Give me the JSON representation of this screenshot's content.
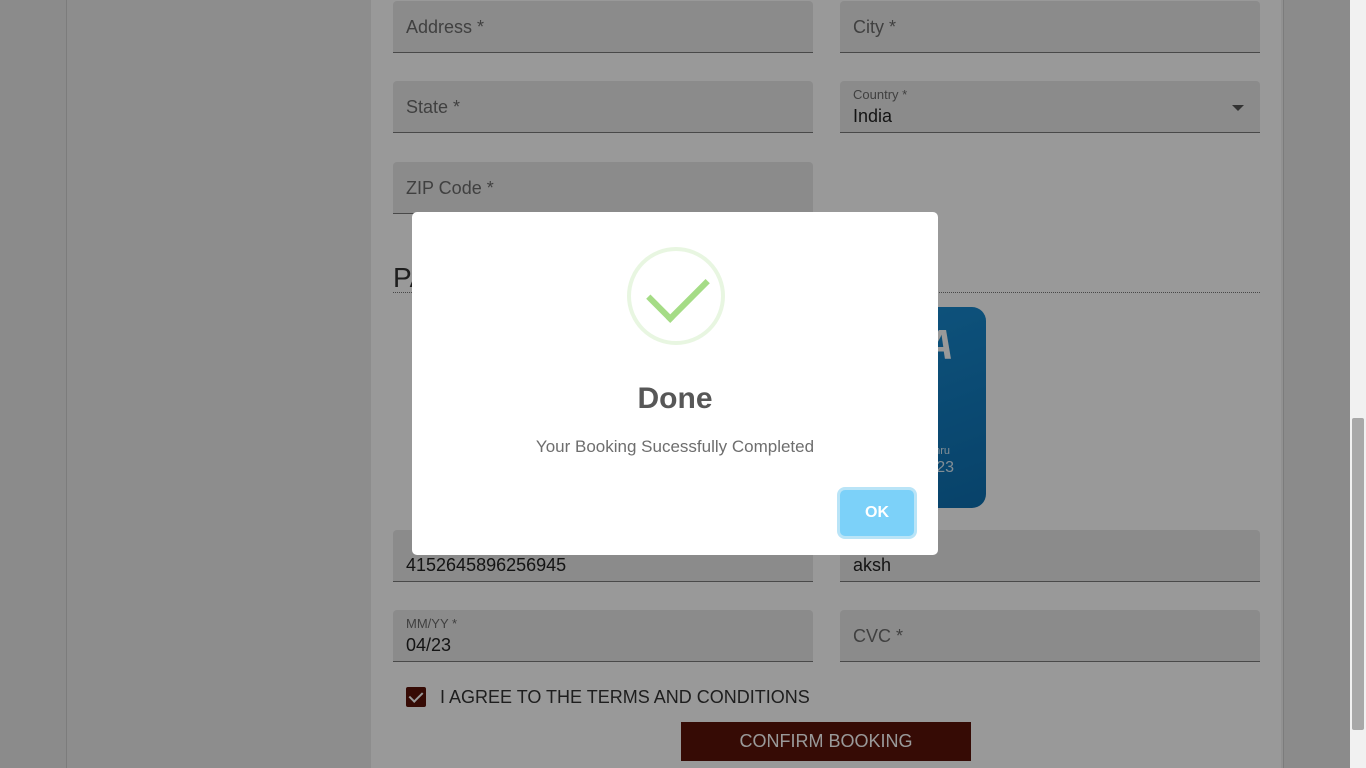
{
  "address_form": {
    "address_placeholder": "Address *",
    "city_placeholder": "City *",
    "state_placeholder": "State *",
    "country_label": "Country *",
    "country_value": "India",
    "zip_placeholder": "ZIP Code *"
  },
  "payment": {
    "section_title_visible": "PA",
    "card_brand_partial": "A",
    "card_name_partial": "nru",
    "card_expiry_partial": "23",
    "card_number_value": "4152645896256945",
    "card_name_value": "aksh",
    "expiry_label": "MM/YY *",
    "expiry_value": "04/23",
    "cvc_placeholder": "CVC *"
  },
  "terms": {
    "label": "I AGREE TO THE TERMS AND CONDITIONS",
    "checked": true
  },
  "confirm_button": "CONFIRM BOOKING",
  "dialog": {
    "title": "Done",
    "message": "Your Booking Sucessfully Completed",
    "ok_label": "OK",
    "icon": "success-check-icon"
  },
  "colors": {
    "accent": "#5a1309",
    "success": "#a5dc86",
    "ok_button": "#7cd1f9"
  }
}
